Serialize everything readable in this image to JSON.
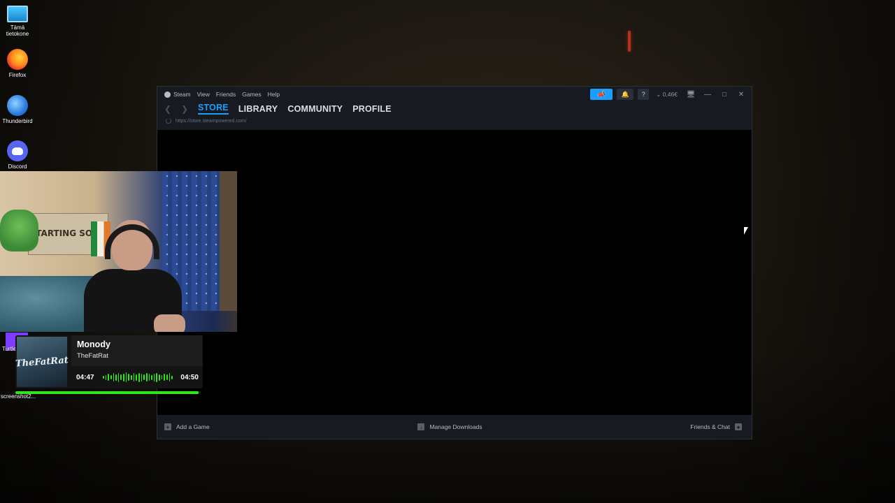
{
  "desktop": {
    "icons": [
      {
        "label": "Tämä tietokone",
        "icon": "computer-icon"
      },
      {
        "label": "Firefox",
        "icon": "firefox-icon"
      },
      {
        "label": "Thunderbird",
        "icon": "thunderbird-icon"
      },
      {
        "label": "Discord",
        "icon": "discord-icon"
      }
    ],
    "partial_label": "Turtle Swa",
    "screenshot_label": "screenshot2..."
  },
  "steam": {
    "menu": [
      "Steam",
      "View",
      "Friends",
      "Games",
      "Help"
    ],
    "wallet": "0,46€",
    "help_glyph": "?",
    "nav_tabs": [
      "STORE",
      "LIBRARY",
      "COMMUNITY",
      "PROFILE"
    ],
    "active_tab": "STORE",
    "url": "https://store.steampowered.com/",
    "footer": {
      "add_game": "Add a Game",
      "manage_downloads": "Manage Downloads",
      "friends_chat": "Friends & Chat"
    }
  },
  "webcam": {
    "poster_text": "STARTING SOON"
  },
  "now_playing": {
    "title": "Monody",
    "artist": "TheFatRat",
    "art_text": "TheFatRat",
    "elapsed": "04:47",
    "total": "04:50",
    "progress": 0.99,
    "accent_color": "#2ee61a"
  }
}
